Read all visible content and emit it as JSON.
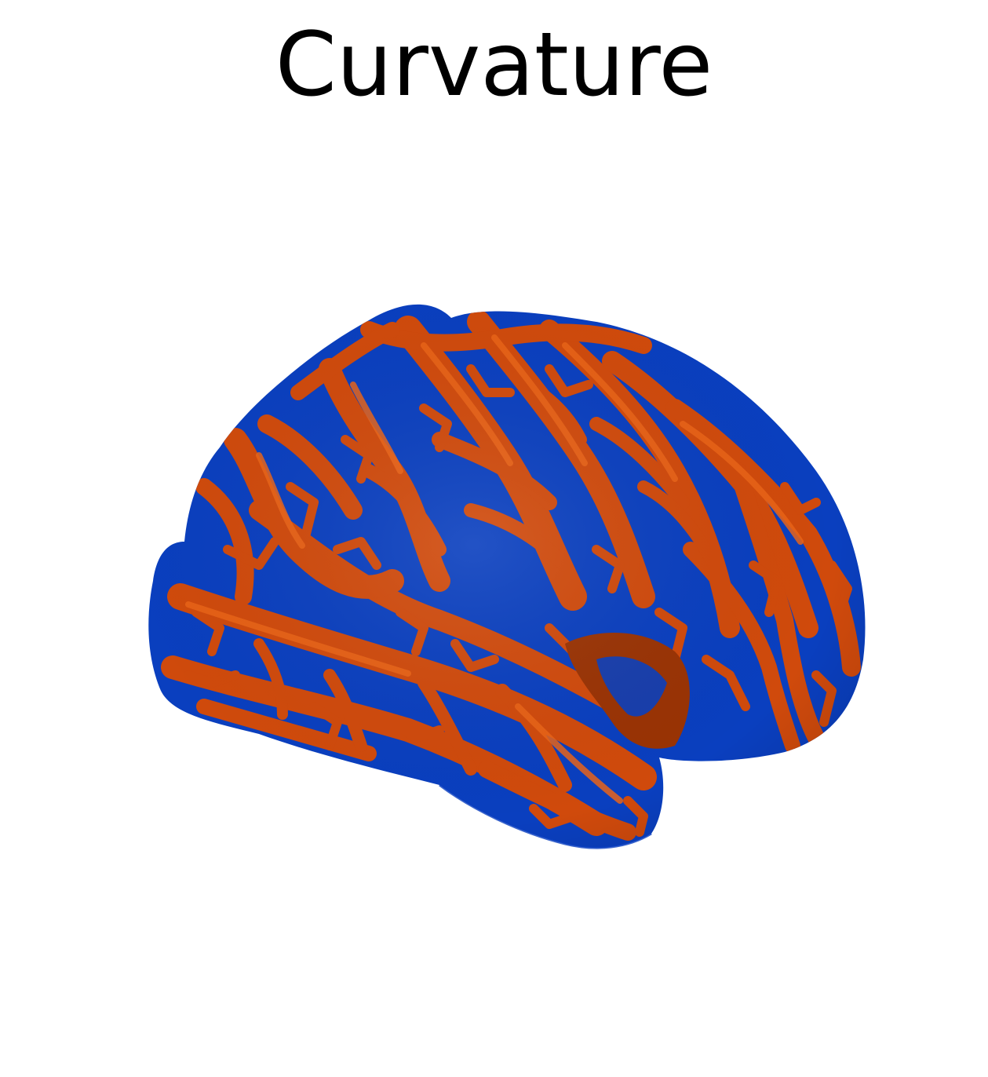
{
  "figure": {
    "title": "Curvature"
  },
  "colors": {
    "background": "#ffffff",
    "title_text": "#000000",
    "sulcus_blue": "#0a3fbf",
    "gyrus_orange": "#d04a0c",
    "gyrus_highlight": "#ea6418",
    "insula_dark": "#9a3304"
  }
}
